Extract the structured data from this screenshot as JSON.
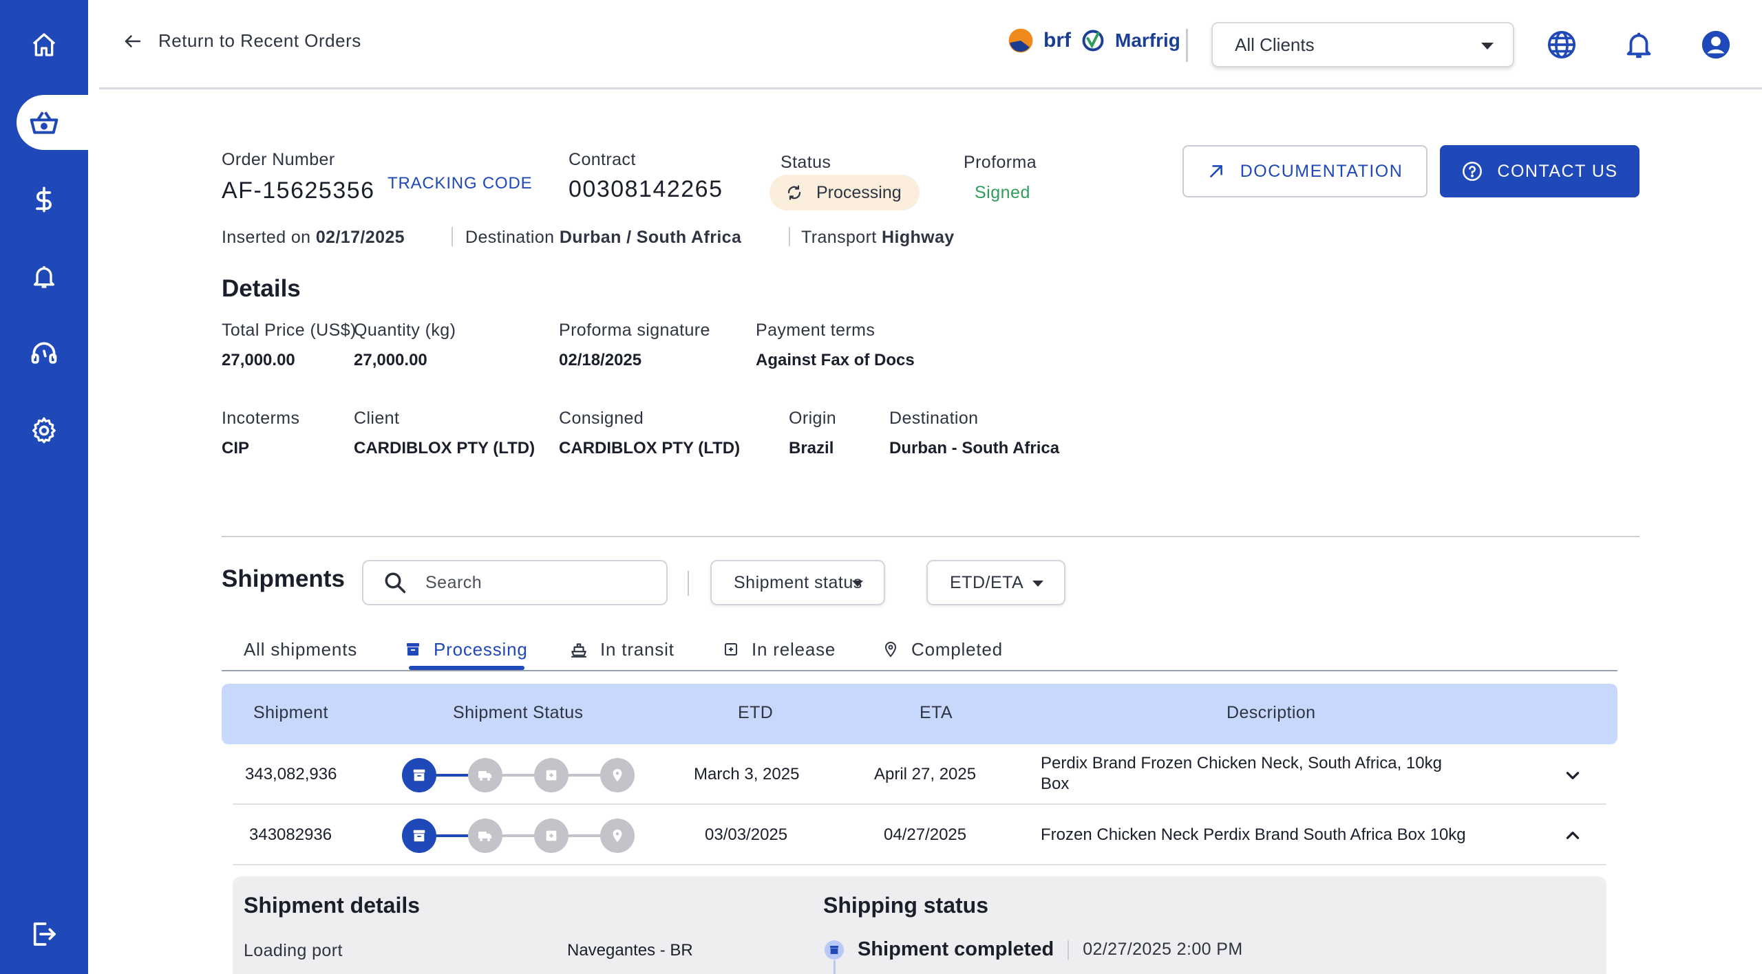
{
  "header": {
    "back_label": "Return to Recent Orders",
    "brand_1": "brf",
    "brand_2": "Marfrig",
    "client_select": "All Clients"
  },
  "sidebar": {
    "items": [
      {
        "icon": "home-icon"
      },
      {
        "icon": "basket-icon",
        "active": true
      },
      {
        "icon": "dollar-icon"
      },
      {
        "icon": "bell-icon"
      },
      {
        "icon": "support-icon"
      },
      {
        "icon": "gear-icon"
      }
    ],
    "logout_icon": "logout-icon"
  },
  "order": {
    "number_label": "Order Number",
    "number": "AF-15625356",
    "tracking_code": "TRACKING CODE",
    "contract_label": "Contract",
    "contract": "00308142265",
    "status_label": "Status",
    "status": "Processing",
    "proforma_label": "Proforma",
    "proforma": "Signed",
    "documentation_button": "DOCUMENTATION",
    "contact_button": "CONTACT US",
    "inserted_label": "Inserted on",
    "inserted": "02/17/2025",
    "destination_label": "Destination",
    "destination": "Durban / South Africa",
    "transport_label": "Transport",
    "transport": "Highway"
  },
  "details": {
    "title": "Details",
    "total_price_label": "Total Price (US$)",
    "total_price": "27,000.00",
    "quantity_label": "Quantity (kg)",
    "quantity": "27,000.00",
    "proforma_signature_label": "Proforma signature",
    "proforma_signature": "02/18/2025",
    "payment_terms_label": "Payment terms",
    "payment_terms": "Against Fax of Docs",
    "incoterms_label": "Incoterms",
    "incoterms": "CIP",
    "client_label": "Client",
    "client": "CARDIBLOX PTY (LTD)",
    "consigned_label": "Consigned",
    "consigned": "CARDIBLOX PTY (LTD)",
    "origin_label": "Origin",
    "origin": "Brazil",
    "destination_label": "Destination",
    "destination": "Durban - South Africa"
  },
  "shipments": {
    "title": "Shipments",
    "search_placeholder": "Search",
    "status_filter": "Shipment status",
    "date_filter": "ETD/ETA",
    "tabs": [
      {
        "label": "All shipments"
      },
      {
        "label": "Processing",
        "active": true
      },
      {
        "label": "In transit"
      },
      {
        "label": "In release"
      },
      {
        "label": "Completed"
      }
    ],
    "columns": {
      "shipment": "Shipment",
      "status": "Shipment Status",
      "etd": "ETD",
      "eta": "ETA",
      "description": "Description"
    },
    "rows": [
      {
        "shipment": "343,082,936",
        "etd": "March 3, 2025",
        "eta": "April 27, 2025",
        "description_1": "Perdix Brand Frozen Chicken Neck, South Africa, 10kg",
        "description_2": "Box",
        "expanded": false,
        "steps_done": 1,
        "steps_total": 4
      },
      {
        "shipment": "343082936",
        "etd": "03/03/2025",
        "eta": "04/27/2025",
        "description_1": "Frozen Chicken Neck Perdix Brand South Africa Box 10kg",
        "expanded": true,
        "steps_done": 1,
        "steps_total": 4
      }
    ]
  },
  "shipment_details": {
    "title": "Shipment details",
    "loading_port_label": "Loading port",
    "loading_port": "Navegantes - BR",
    "shipping_status_title": "Shipping status",
    "status_event": "Shipment completed",
    "status_date": "02/27/2025 2:00 PM"
  },
  "colors": {
    "brand_blue": "#1f48b8",
    "table_header": "#c8d8fd",
    "status_pill": "#fbeedd",
    "signed_green": "#2f9e5a"
  }
}
